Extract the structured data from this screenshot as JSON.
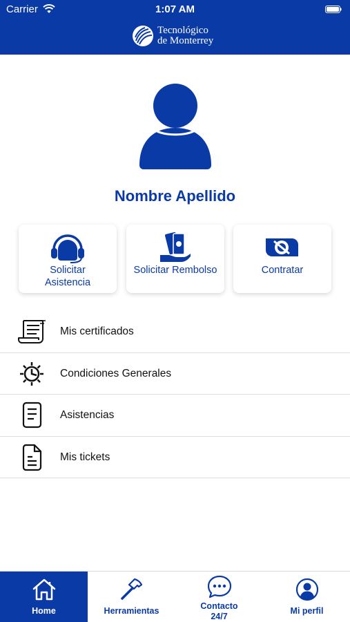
{
  "status_bar": {
    "carrier": "Carrier",
    "time": "1:07 AM",
    "wifi_icon": "wifi-icon",
    "battery_icon": "battery-icon"
  },
  "header": {
    "brand_line1": "Tecnológico",
    "brand_line2": "de Monterrey",
    "background": "#0a3aa5"
  },
  "profile": {
    "name": "Nombre Apellido",
    "avatar_icon": "person-icon"
  },
  "actions": [
    {
      "label_line1": "Solicitar",
      "label_line2": "Asistencia",
      "icon": "headset-icon"
    },
    {
      "label": "Solicitar Rembolso",
      "icon": "money-hand-icon"
    },
    {
      "label": "Contratar",
      "icon": "contract-icon"
    }
  ],
  "menu": [
    {
      "label": "Mis certificados",
      "icon": "certificate-icon"
    },
    {
      "label": "Condiciones Generales",
      "icon": "gear-icon"
    },
    {
      "label": "Asistencias",
      "icon": "document-icon"
    },
    {
      "label": "Mis tickets",
      "icon": "ticket-file-icon"
    }
  ],
  "tabbar": {
    "active": "Home",
    "tabs": [
      {
        "label": "Home",
        "icon": "home-icon"
      },
      {
        "label": "Herramientas",
        "icon": "hammer-icon"
      },
      {
        "label_line1": "Contacto",
        "label_line2": "24/7",
        "icon": "chat-icon"
      },
      {
        "label": "Mi perfil",
        "icon": "profile-icon"
      }
    ]
  },
  "colors": {
    "primary": "#0a3aa5",
    "text": "#111111",
    "divider": "#dddddd"
  }
}
